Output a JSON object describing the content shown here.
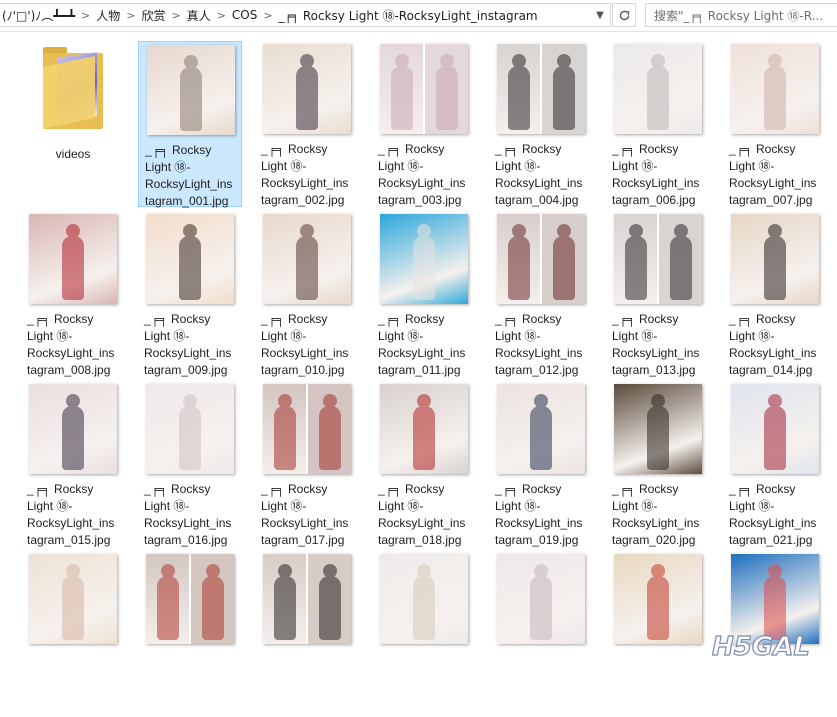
{
  "address_bar": {
    "breadcrumbs": [
      "(ﾉ'□')ﾉ︵┻━┻",
      "人物",
      "欣赏",
      "真人",
      "COS",
      "_╒╕ Rocksy Light ⑱-RocksyLight_instagram"
    ],
    "search_placeholder": "搜索\"_╒╕ Rocksy Light ⑱-R..."
  },
  "folder": {
    "label": "videos"
  },
  "files": [
    {
      "line1": "_╒╕ Rocksy",
      "line2": "Light ⑱-",
      "line3": "RocksyLight_ins",
      "line4": "tagram_001.jpg",
      "selected": true,
      "colors": [
        "#e6d8cd",
        "#8a7a6e"
      ],
      "split": false
    },
    {
      "line1": "_╒╕ Rocksy",
      "line2": "Light ⑱-",
      "line3": "RocksyLight_ins",
      "line4": "tagram_002.jpg",
      "selected": false,
      "colors": [
        "#e9ddd0",
        "#3a2f3a"
      ],
      "split": false
    },
    {
      "line1": "_╒╕ Rocksy",
      "line2": "Light ⑱-",
      "line3": "RocksyLight_ins",
      "line4": "tagram_003.jpg",
      "selected": false,
      "colors": [
        "#e5d8dc",
        "#c9a8b4"
      ],
      "split": true
    },
    {
      "line1": "_╒╕ Rocksy",
      "line2": "Light ⑱-",
      "line3": "RocksyLight_ins",
      "line4": "tagram_004.jpg",
      "selected": false,
      "colors": [
        "#d8d4d2",
        "#2e2a2c"
      ],
      "split": true
    },
    {
      "line1": "_╒╕ Rocksy",
      "line2": "Light ⑱-",
      "line3": "RocksyLight_ins",
      "line4": "tagram_006.jpg",
      "selected": false,
      "colors": [
        "#eceaea",
        "#bdb5b6"
      ],
      "split": false
    },
    {
      "line1": "_╒╕ Rocksy",
      "line2": "Light ⑱-",
      "line3": "RocksyLight_ins",
      "line4": "tagram_007.jpg",
      "selected": false,
      "colors": [
        "#efe1d9",
        "#cdb2a6"
      ],
      "split": false
    },
    {
      "line1": "_╒╕ Rocksy",
      "line2": "Light ⑱-",
      "line3": "RocksyLight_ins",
      "line4": "tagram_008.jpg",
      "selected": false,
      "colors": [
        "#d8b6b4",
        "#b2202a"
      ],
      "split": false
    },
    {
      "line1": "_╒╕ Rocksy",
      "line2": "Light ⑱-",
      "line3": "RocksyLight_ins",
      "line4": "tagram_009.jpg",
      "selected": false,
      "colors": [
        "#f2ddca",
        "#3a2a26"
      ],
      "split": false
    },
    {
      "line1": "_╒╕ Rocksy",
      "line2": "Light ⑱-",
      "line3": "RocksyLight_ins",
      "line4": "tagram_010.jpg",
      "selected": false,
      "colors": [
        "#e8d8cc",
        "#5a3b33"
      ],
      "split": false
    },
    {
      "line1": "_╒╕ Rocksy",
      "line2": "Light ⑱-",
      "line3": "RocksyLight_ins",
      "line4": "tagram_011.jpg",
      "selected": false,
      "colors": [
        "#2ca7da",
        "#e8e4e0"
      ],
      "split": false
    },
    {
      "line1": "_╒╕ Rocksy",
      "line2": "Light ⑱-",
      "line3": "RocksyLight_ins",
      "line4": "tagram_012.jpg",
      "selected": false,
      "colors": [
        "#d8cfcc",
        "#6b2a2a"
      ],
      "split": true
    },
    {
      "line1": "_╒╕ Rocksy",
      "line2": "Light ⑱-",
      "line3": "RocksyLight_ins",
      "line4": "tagram_013.jpg",
      "selected": false,
      "colors": [
        "#d9d4d2",
        "#2c2a2a"
      ],
      "split": true
    },
    {
      "line1": "_╒╕ Rocksy",
      "line2": "Light ⑱-",
      "line3": "RocksyLight_ins",
      "line4": "tagram_014.jpg",
      "selected": false,
      "colors": [
        "#e6d6c6",
        "#2b2424"
      ],
      "split": false
    },
    {
      "line1": "_╒╕ Rocksy",
      "line2": "Light ⑱-",
      "line3": "RocksyLight_ins",
      "line4": "tagram_015.jpg",
      "selected": false,
      "colors": [
        "#e9dfe0",
        "#3a3043"
      ],
      "split": false
    },
    {
      "line1": "_╒╕ Rocksy",
      "line2": "Light ⑱-",
      "line3": "RocksyLight_ins",
      "line4": "tagram_016.jpg",
      "selected": false,
      "colors": [
        "#efe9ea",
        "#cfc2c4"
      ],
      "split": false
    },
    {
      "line1": "_╒╕ Rocksy",
      "line2": "Light ⑱-",
      "line3": "RocksyLight_ins",
      "line4": "tagram_017.jpg",
      "selected": false,
      "colors": [
        "#d4c5c2",
        "#a5332e"
      ],
      "split": true
    },
    {
      "line1": "_╒╕ Rocksy",
      "line2": "Light ⑱-",
      "line3": "RocksyLight_ins",
      "line4": "tagram_018.jpg",
      "selected": false,
      "colors": [
        "#d8d1cf",
        "#b42626"
      ],
      "split": false
    },
    {
      "line1": "_╒╕ Rocksy",
      "line2": "Light ⑱-",
      "line3": "RocksyLight_ins",
      "line4": "tagram_019.jpg",
      "selected": false,
      "colors": [
        "#ebe3df",
        "#2a3450"
      ],
      "split": false
    },
    {
      "line1": "_╒╕ Rocksy",
      "line2": "Light ⑱-",
      "line3": "RocksyLight_ins",
      "line4": "tagram_020.jpg",
      "selected": false,
      "colors": [
        "#5a4a3a",
        "#2e2620"
      ],
      "split": false
    },
    {
      "line1": "_╒╕ Rocksy",
      "line2": "Light ⑱-",
      "line3": "RocksyLight_ins",
      "line4": "tagram_021.jpg",
      "selected": false,
      "colors": [
        "#dfe4ee",
        "#a6243a"
      ],
      "split": false
    },
    {
      "line1": "",
      "line2": "",
      "line3": "",
      "line4": "",
      "selected": false,
      "colors": [
        "#efe2d4",
        "#d8b6a8"
      ],
      "split": false
    },
    {
      "line1": "",
      "line2": "",
      "line3": "",
      "line4": "",
      "selected": false,
      "colors": [
        "#d4c7c2",
        "#b03a2e"
      ],
      "split": true
    },
    {
      "line1": "",
      "line2": "",
      "line3": "",
      "line4": "",
      "selected": false,
      "colors": [
        "#d6cdc6",
        "#2a2424"
      ],
      "split": true
    },
    {
      "line1": "",
      "line2": "",
      "line3": "",
      "line4": "",
      "selected": false,
      "colors": [
        "#eeeceb",
        "#d7c9b8"
      ],
      "split": false
    },
    {
      "line1": "",
      "line2": "",
      "line3": "",
      "line4": "",
      "selected": false,
      "colors": [
        "#efe8ea",
        "#c9b6be"
      ],
      "split": false
    },
    {
      "line1": "",
      "line2": "",
      "line3": "",
      "line4": "",
      "selected": false,
      "colors": [
        "#e8d8c0",
        "#c23a2a"
      ],
      "split": false
    },
    {
      "line1": "",
      "line2": "",
      "line3": "",
      "line4": "",
      "selected": false,
      "colors": [
        "#1f6fbf",
        "#e04a4a"
      ],
      "split": false
    }
  ],
  "watermark": {
    "text": "H5GAL"
  }
}
